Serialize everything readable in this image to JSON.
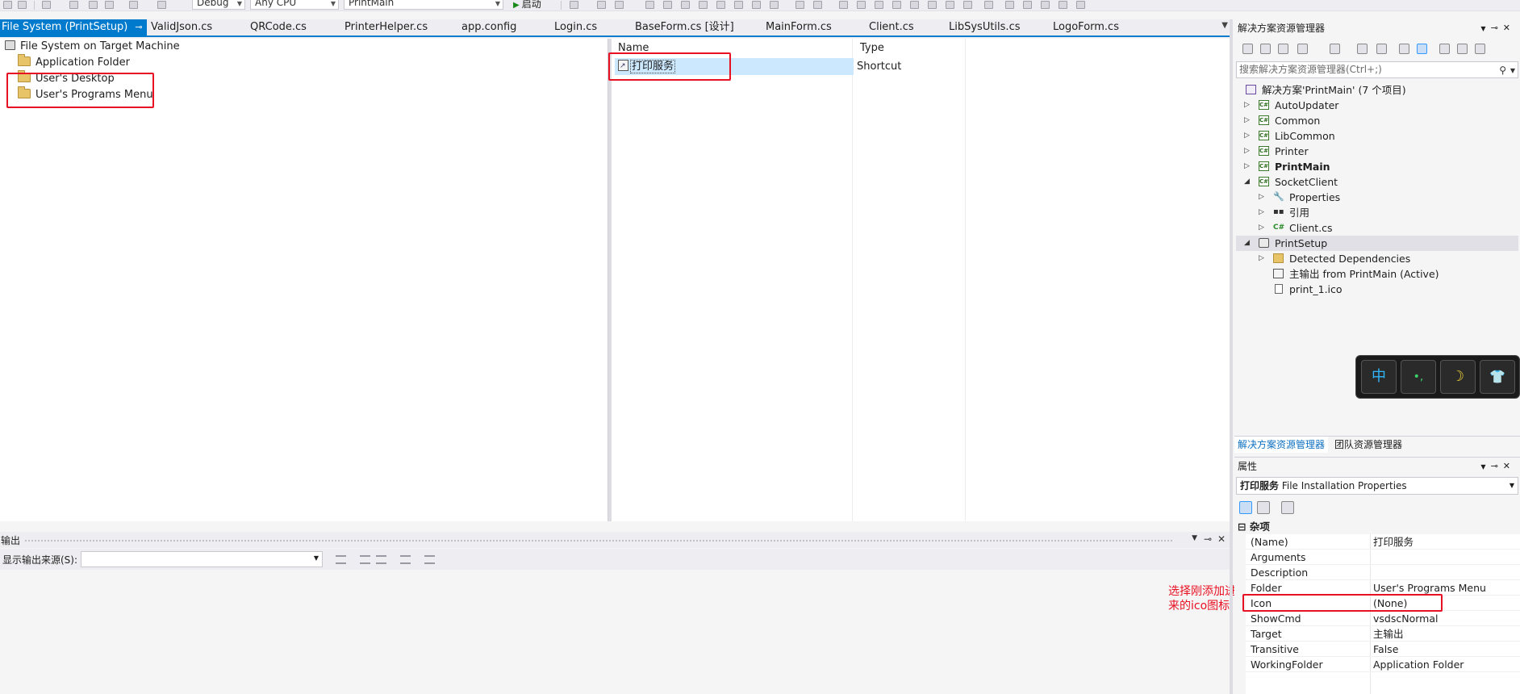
{
  "toolbar": {
    "config": "Debug",
    "platform": "Any CPU",
    "startup_project": "PrintMain",
    "start_label": "启动"
  },
  "tabs": [
    {
      "label": "File System (PrintSetup)",
      "active": true
    },
    {
      "label": "ValidJson.cs"
    },
    {
      "label": "QRCode.cs"
    },
    {
      "label": "PrinterHelper.cs"
    },
    {
      "label": "app.config"
    },
    {
      "label": "Login.cs"
    },
    {
      "label": "BaseForm.cs [设计]"
    },
    {
      "label": "MainForm.cs"
    },
    {
      "label": "Client.cs"
    },
    {
      "label": "LibSysUtils.cs"
    },
    {
      "label": "LogoForm.cs"
    }
  ],
  "fs_tree": {
    "root": "File System on Target Machine",
    "folders": [
      "Application Folder",
      "User's Desktop",
      "User's Programs Menu"
    ]
  },
  "fs_list": {
    "col_name": "Name",
    "col_type": "Type",
    "item_name": "打印服务",
    "item_type": "Shortcut"
  },
  "output": {
    "title": "输出",
    "source_label": "显示输出来源(S):",
    "source_value": ""
  },
  "annotation": "选择刚添加进来的ico图标",
  "solution_explorer": {
    "title": "解决方案资源管理器",
    "search_placeholder": "搜索解决方案资源管理器(Ctrl+;)",
    "solution": "解决方案'PrintMain' (7 个项目)",
    "projects": [
      "AutoUpdater",
      "Common",
      "LibCommon",
      "Printer",
      "PrintMain",
      "SocketClient"
    ],
    "socketclient_children": [
      "Properties",
      "引用",
      "Client.cs"
    ],
    "setup_project": "PrintSetup",
    "setup_children": [
      "Detected Dependencies",
      "主输出 from PrintMain (Active)",
      "print_1.ico"
    ]
  },
  "ime": {
    "b1": "中",
    "b2": "•,",
    "b3": "☽",
    "b4": "👕"
  },
  "bottom_tabs": [
    "解决方案资源管理器",
    "团队资源管理器"
  ],
  "properties": {
    "title": "属性",
    "object_name": "打印服务",
    "object_type": "File Installation Properties",
    "category": "杂项",
    "rows": [
      {
        "k": "(Name)",
        "v": "打印服务"
      },
      {
        "k": "Arguments",
        "v": ""
      },
      {
        "k": "Description",
        "v": ""
      },
      {
        "k": "Folder",
        "v": "User's Programs Menu"
      },
      {
        "k": "Icon",
        "v": "(None)"
      },
      {
        "k": "ShowCmd",
        "v": "vsdscNormal"
      },
      {
        "k": "Target",
        "v": "主输出"
      },
      {
        "k": "Transitive",
        "v": "False"
      },
      {
        "k": "WorkingFolder",
        "v": "Application Folder"
      }
    ]
  },
  "colors": {
    "accent": "#007acc",
    "highlight": "#e81123",
    "selection": "#cce8ff"
  }
}
